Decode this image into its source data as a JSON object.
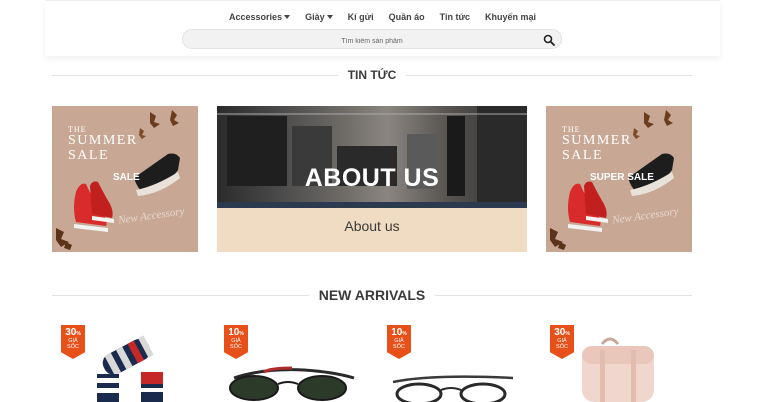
{
  "nav": {
    "items": [
      {
        "label": "Accessories",
        "dropdown": true
      },
      {
        "label": "Giày",
        "dropdown": true
      },
      {
        "label": "Kí gửi",
        "dropdown": false
      },
      {
        "label": "Quần áo",
        "dropdown": false
      },
      {
        "label": "Tin tức",
        "dropdown": false
      },
      {
        "label": "Khuyến mại",
        "dropdown": false
      }
    ]
  },
  "search": {
    "placeholder": "Tìm kiếm sản phẩm",
    "icon": "search-icon"
  },
  "news": {
    "title": "TIN TỨC",
    "banners": [
      {
        "line1": "THE",
        "line2": "SUMMER",
        "line3": "SALE",
        "label": "SALE",
        "script": "New Accessory"
      },
      {
        "title": "ABOUT US",
        "caption": "About us"
      },
      {
        "line1": "THE",
        "line2": "SUMMER",
        "line3": "SALE",
        "label": "SUPER SALE",
        "script": "New Accessory"
      }
    ]
  },
  "arrivals": {
    "title": "NEW ARRIVALS",
    "products": [
      {
        "discount": "30",
        "unit": "%",
        "label1": "GIẢ",
        "label2": "SỐC"
      },
      {
        "discount": "10",
        "unit": "%",
        "label1": "GIẢ",
        "label2": "SỐC"
      },
      {
        "discount": "10",
        "unit": "%",
        "label1": "GIẢ",
        "label2": "SỐC"
      },
      {
        "discount": "30",
        "unit": "%",
        "label1": "GIẢ",
        "label2": "SỐC"
      }
    ]
  },
  "colors": {
    "badge": "#e8501a",
    "promo_bg": "#c8a894",
    "about_bg": "#f0dcc2"
  }
}
